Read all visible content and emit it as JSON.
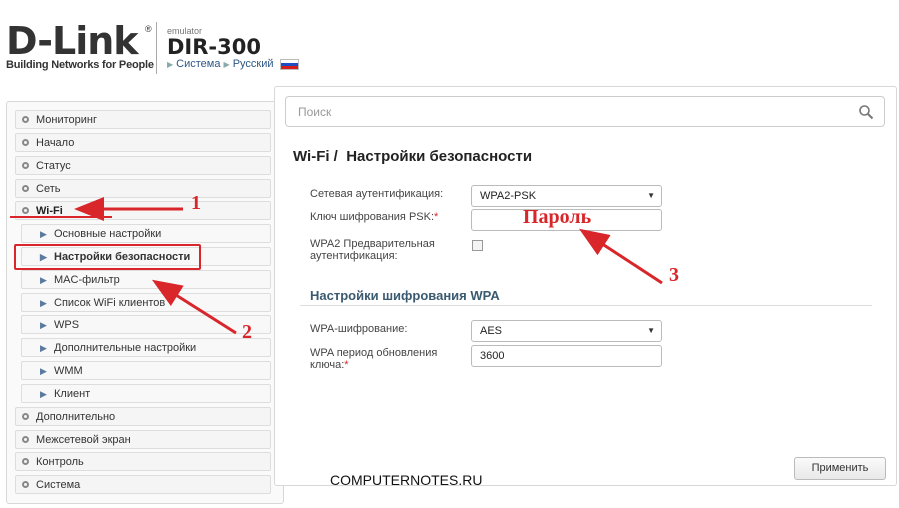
{
  "header": {
    "logo_text": "D-Link",
    "logo_tagline": "Building Networks for People",
    "model_label": "emulator",
    "model": "DIR-300",
    "breadcrumb": [
      "Система",
      "Русский"
    ]
  },
  "search": {
    "placeholder": "Поиск"
  },
  "sidebar": {
    "items": [
      {
        "label": "Мониторинг"
      },
      {
        "label": "Начало"
      },
      {
        "label": "Статус"
      },
      {
        "label": "Сеть"
      },
      {
        "label": "Wi-Fi",
        "expanded": true
      },
      {
        "label": "Основные настройки",
        "sub": true
      },
      {
        "label": "Настройки безопасности",
        "sub": true,
        "active": true
      },
      {
        "label": "MAC-фильтр",
        "sub": true
      },
      {
        "label": "Список WiFi клиентов",
        "sub": true
      },
      {
        "label": "WPS",
        "sub": true
      },
      {
        "label": "Дополнительные настройки",
        "sub": true
      },
      {
        "label": "WMM",
        "sub": true
      },
      {
        "label": "Клиент",
        "sub": true
      },
      {
        "label": "Дополнительно"
      },
      {
        "label": "Межсетевой экран"
      },
      {
        "label": "Контроль"
      },
      {
        "label": "Система"
      }
    ]
  },
  "main": {
    "title_prefix": "Wi-Fi /",
    "title": "Настройки безопасности",
    "auth_label": "Сетевая аутентификация:",
    "auth_value": "WPA2-PSK",
    "psk_label": "Ключ шифрования PSK:",
    "psk_required": "*",
    "preauth_label_1": "WPA2 Предварительная",
    "preauth_label_2": "аутентификация:",
    "preauth_checked": false,
    "section_title": "Настройки шифрования WPA",
    "enc_label": "WPA-шифрование:",
    "enc_value": "AES",
    "period_label_1": "WPA период обновления",
    "period_label_2": "ключа:",
    "period_required": "*",
    "period_value": "3600",
    "apply_label": "Применить"
  },
  "annotations": {
    "password_label": "Пароль",
    "marker_1": "1",
    "marker_2": "2",
    "marker_3": "3",
    "accent_color": "#d9262b"
  },
  "watermark": "COMPUTERNOTES.RU"
}
